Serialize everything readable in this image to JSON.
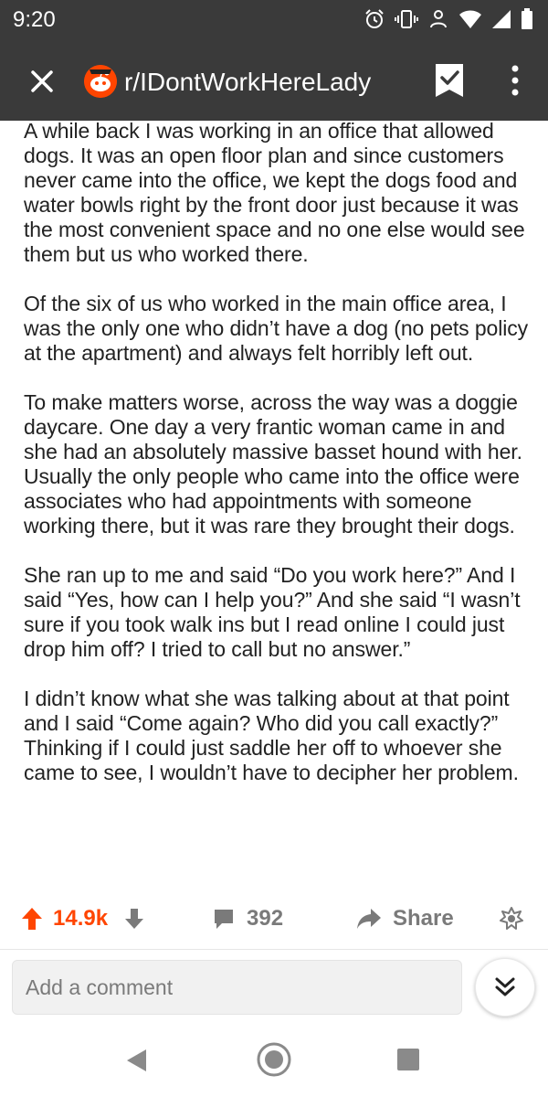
{
  "status_bar": {
    "time": "9:20",
    "icons": [
      "alarm-icon",
      "vibrate-icon",
      "data-saver-icon",
      "wifi-icon",
      "signal-icon",
      "battery-icon"
    ]
  },
  "app_bar": {
    "close_icon": "close-icon",
    "subreddit": "r/IDontWorkHereLady",
    "bookmark_icon": "bookmark-check-icon",
    "more_icon": "more-vertical-icon",
    "background": "#3a3a3a"
  },
  "post": {
    "paragraphs": [
      "A while back I was working in an office that allowed dogs. It was an open floor plan and since customers never came into the office, we kept the dogs food and water bowls right by the front door just because it was the most convenient space and no one else would see them but us who worked there.",
      "Of the six of us who worked in the main office area, I was the only one who didn’t have a dog (no pets policy at the apartment) and always felt horribly left out.",
      "To make matters worse, across the way was a doggie daycare. One day a very frantic woman came in and she had an absolutely massive basset hound with her. Usually the only people who came into the office were associates who had appointments with someone working there, but it was rare they brought their dogs.",
      "She ran up to me and said “Do you work here?” And I said “Yes, how can I help you?” And she said “I wasn’t sure if you took walk ins but I read online I could just drop him off? I tried to call but no answer.”",
      "I didn’t know what she was talking about at that point and I said “Come again? Who did you call exactly?” Thinking if I could just saddle her off to whoever she came to see, I wouldn’t have to decipher her problem."
    ]
  },
  "actions": {
    "score": "14.9k",
    "comments": "392",
    "share_label": "Share",
    "upvote_color": "#ff4500",
    "muted_color": "#7a7a7a"
  },
  "comment_bar": {
    "placeholder": "Add a comment"
  },
  "nav_bar": {
    "icons": [
      "back-icon",
      "home-icon",
      "recents-icon"
    ]
  }
}
